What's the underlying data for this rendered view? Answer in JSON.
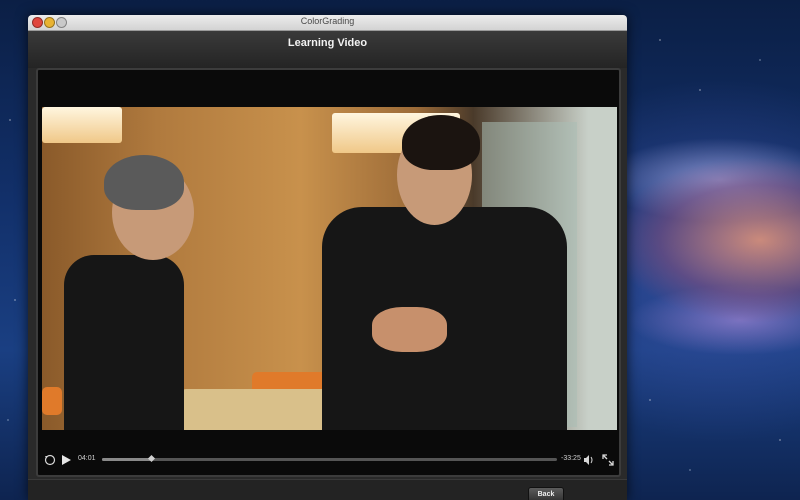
{
  "window": {
    "title": "ColorGrading"
  },
  "header": {
    "title": "Learning Video"
  },
  "player": {
    "elapsed": "04:01",
    "remaining": "-33:25",
    "progress_fraction": 0.107,
    "controls": {
      "replay_icon": "replay-30-icon",
      "play_icon": "play-icon",
      "volume_icon": "volume-icon",
      "fullscreen_icon": "fullscreen-icon"
    }
  },
  "footer": {
    "back_label": "Back"
  },
  "colors": {
    "window_bg": "#1c1c1c",
    "header_bg": "#2a2a2a",
    "accent_text": "#f2f2f2"
  }
}
